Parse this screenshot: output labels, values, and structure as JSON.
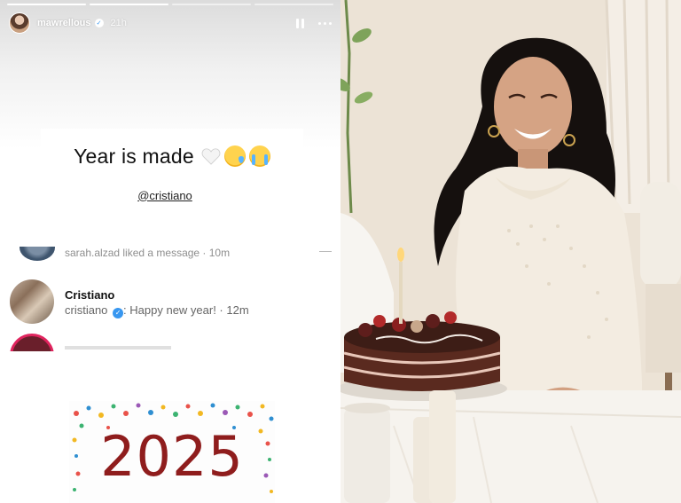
{
  "story": {
    "username": "mawrellous",
    "verified_mark": "✓",
    "time": "21h",
    "caption": "Year is made",
    "mention": "@cristiano",
    "icons": [
      "pause-icon",
      "more-icon",
      "heart-icon",
      "tear-face-icon",
      "crying-face-icon"
    ]
  },
  "notifications": {
    "partial_text": "sarah.alzad liked a message · 10m",
    "item": {
      "name": "Cristiano",
      "handle": "cristiano",
      "verified_mark": "✓",
      "message": ": Happy new year! · 12m"
    }
  },
  "card": {
    "year": "2025"
  },
  "colors": {
    "accent_red": "#8f1d1d",
    "verified_blue": "#3897f0"
  }
}
